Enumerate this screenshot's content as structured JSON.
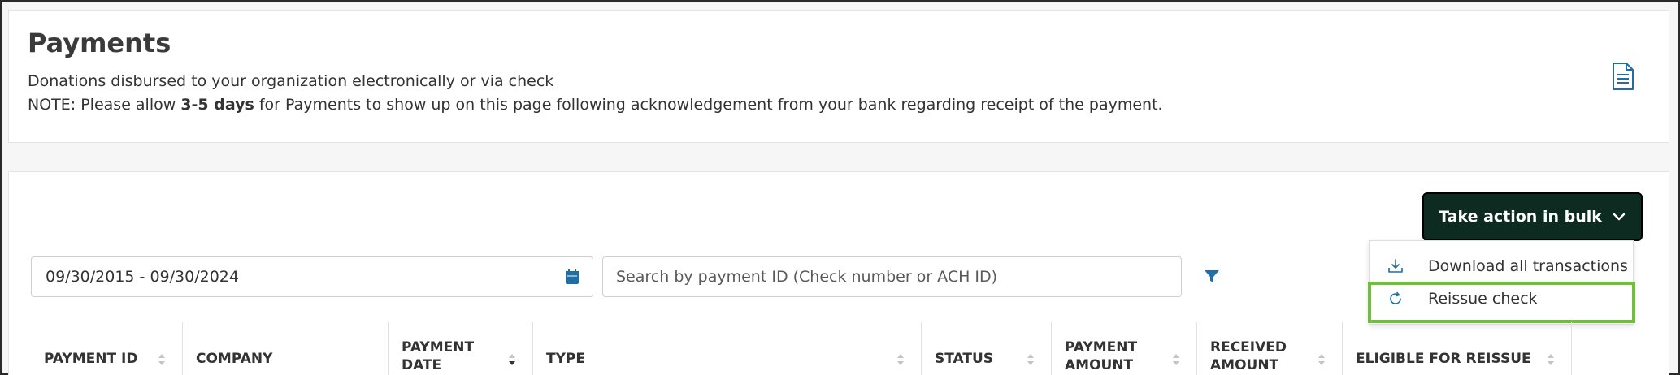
{
  "header": {
    "title": "Payments",
    "subtitle": "Donations disbursed to your organization electronically or via check",
    "note_prefix": "NOTE: Please allow ",
    "note_bold": "3-5 days",
    "note_suffix": " for Payments to show up on this page following acknowledgement from your bank regarding receipt of the payment.",
    "doc_icon": "document-icon"
  },
  "toolbar": {
    "bulk_button_label": "Take action in bulk",
    "bulk_menu": [
      {
        "label": "Download all transactions",
        "icon": "download-icon"
      },
      {
        "label": "Reissue check",
        "icon": "refresh-icon"
      }
    ],
    "highlighted_item": "Reissue check"
  },
  "filters": {
    "date_range": "09/30/2015 - 09/30/2024",
    "search_placeholder": "Search by payment ID (Check number or ACH ID)",
    "search_value": ""
  },
  "table": {
    "columns": [
      {
        "label": "PAYMENT ID",
        "sortable": true
      },
      {
        "label": "COMPANY",
        "sortable": false
      },
      {
        "label": "PAYMENT DATE",
        "sortable": true,
        "sorted": "desc"
      },
      {
        "label": "TYPE",
        "sortable": true
      },
      {
        "label": "STATUS",
        "sortable": true
      },
      {
        "label": "PAYMENT AMOUNT",
        "sortable": true
      },
      {
        "label": "RECEIVED AMOUNT",
        "sortable": true
      },
      {
        "label": "ELIGIBLE FOR REISSUE",
        "sortable": true
      }
    ]
  },
  "colors": {
    "accent_blue": "#1f6fa6",
    "bulk_button_bg": "#0e2b22",
    "highlight_green": "#6fbf3a"
  }
}
